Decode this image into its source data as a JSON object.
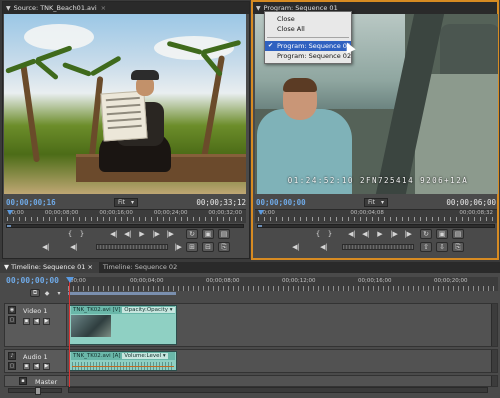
{
  "source_panel": {
    "title": "Source: TNK_Beach01.avi",
    "tab_close_glyph": "×",
    "timecode_current": "00;00;00;16",
    "fit_label": "Fit",
    "timecode_duration": "00;00;33;12",
    "ruler_labels": [
      "00;00",
      "00;00;08;00",
      "00;00;16;00",
      "00;00;24;00",
      "00;00;32;00"
    ]
  },
  "program_panel": {
    "title": "Program: Sequence 01",
    "timecode_current": "00;00;00;00",
    "fit_label": "Fit",
    "timecode_duration": "00;00;06;00",
    "ruler_labels": [
      "00;00",
      "00;00;04;08",
      "00;00;08;32"
    ],
    "burned_timecode": "01:24:52:10  2FN725414  9206+12A"
  },
  "program_menu": {
    "items": [
      {
        "label": "Close",
        "checked": false
      },
      {
        "label": "Close All",
        "checked": false
      },
      {
        "label": "Program: Sequence 01",
        "checked": true
      },
      {
        "label": "Program: Sequence 02",
        "checked": false
      }
    ]
  },
  "timeline": {
    "tabs": [
      "Timeline: Sequence 01",
      "Timeline: Sequence 02"
    ],
    "timecode": "00;00;00;00",
    "ruler_labels": [
      "00;00",
      "00;00;04;00",
      "00;00;08;00",
      "00;00;12;00",
      "00;00;16;00",
      "00;00;20;00"
    ],
    "tracks": {
      "video1": {
        "name": "Video 1",
        "clip_label": "TNK_TK02.avi [V]",
        "effect": "Opacity:Opacity"
      },
      "audio1": {
        "name": "Audio 1",
        "clip_label": "TNK_TK02.avi [A]",
        "effect": "Volume:Level"
      },
      "master": {
        "name": "Master"
      }
    }
  },
  "icons": {
    "play": "▶",
    "step_back": "◀|",
    "step_fwd": "|▶",
    "mark_in": "{",
    "mark_out": "}",
    "loop": "↻",
    "safe": "▣",
    "output": "▤",
    "lift": "⇧",
    "extract": "⇩",
    "insert": "⊞",
    "overlay": "⊟",
    "export": "⎘"
  },
  "colors": {
    "accent_blue": "#6fa9e6",
    "active_border": "#d78b22",
    "clip_teal": "#8fd0c3"
  }
}
